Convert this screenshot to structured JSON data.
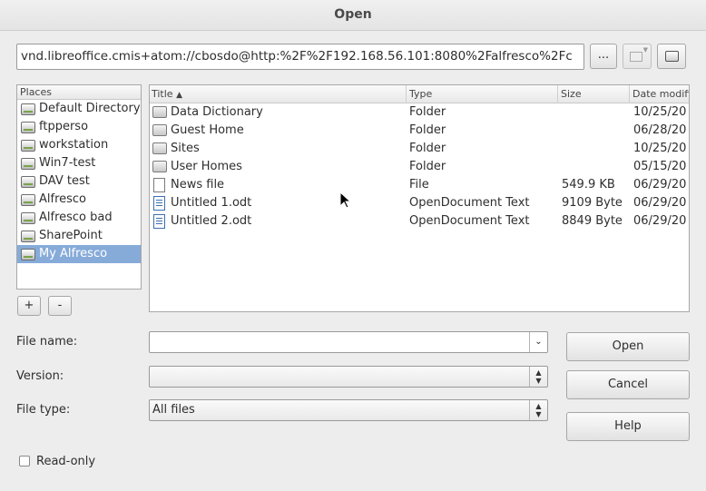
{
  "window": {
    "title": "Open"
  },
  "url_bar": {
    "value": "vnd.libreoffice.cmis+atom://cbosdo@http:%2F%2F192.168.56.101:8080%2Falfresco%2Fc",
    "browse_label": "..."
  },
  "places": {
    "header": "Places",
    "items": [
      "Default Directory",
      "ftpperso",
      "workstation",
      "Win7-test",
      "DAV test",
      "Alfresco",
      "Alfresco bad",
      "SharePoint",
      "My Alfresco"
    ],
    "selected": "My Alfresco",
    "add_label": "+",
    "remove_label": "-"
  },
  "files": {
    "columns": {
      "title": "Title",
      "type": "Type",
      "size": "Size",
      "date": "Date modifi"
    },
    "sort_indicator": "▲",
    "rows": [
      {
        "title": "Data Dictionary",
        "type": "Folder",
        "size": "",
        "date": "10/25/20",
        "icon": "folder-icon"
      },
      {
        "title": "Guest Home",
        "type": "Folder",
        "size": "",
        "date": "06/28/20",
        "icon": "folder-icon"
      },
      {
        "title": "Sites",
        "type": "Folder",
        "size": "",
        "date": "10/25/20",
        "icon": "folder-icon"
      },
      {
        "title": "User Homes",
        "type": "Folder",
        "size": "",
        "date": "05/15/20",
        "icon": "folder-icon"
      },
      {
        "title": "News file",
        "type": "File",
        "size": "549.9 KB",
        "date": "06/29/20",
        "icon": "file-icon"
      },
      {
        "title": "Untitled 1.odt",
        "type": "OpenDocument Text",
        "size": "9109 Byte",
        "date": "06/29/20",
        "icon": "odt-file-icon"
      },
      {
        "title": "Untitled 2.odt",
        "type": "OpenDocument Text",
        "size": "8849 Byte",
        "date": "06/29/20",
        "icon": "odt-file-icon"
      }
    ]
  },
  "form": {
    "file_name_label": "File name:",
    "file_name_value": "",
    "version_label": "Version:",
    "version_value": "",
    "file_type_label": "File type:",
    "file_type_value": "All files",
    "read_only_label": "Read-only",
    "read_only_checked": false
  },
  "buttons": {
    "open": "Open",
    "cancel": "Cancel",
    "help": "Help"
  }
}
